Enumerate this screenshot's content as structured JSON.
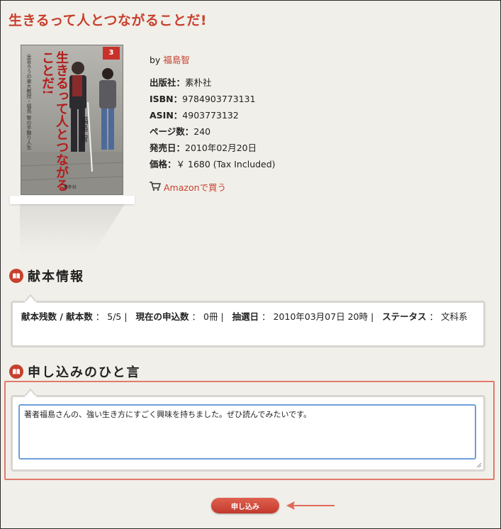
{
  "page": {
    "title": "生きるって人とつながることだ!"
  },
  "book": {
    "cover": {
      "badge": "3",
      "title": "生きるって人とつながることだ!",
      "subtitle": "全盲ろうの東大教授・福島 智の手触り人生",
      "author": "福島 智",
      "publisher": "素朴社"
    },
    "by_label": "by",
    "author": "福島智",
    "publisher_label": "出版社：",
    "publisher": "素朴社",
    "isbn_label": "ISBN：",
    "isbn": "9784903773131",
    "asin_label": "ASIN：",
    "asin": "4903773132",
    "pages_label": "ページ数：",
    "pages": "240",
    "release_label": "発売日：",
    "release": "2010年02月20日",
    "price_label": "価格：",
    "price": "￥ 1680 (Tax Included)",
    "amazon_link": "Amazonで買う"
  },
  "donation_info": {
    "heading": "献本情報",
    "remaining_label": "献本残数 / 献本数",
    "remaining_value": "5/5",
    "applications_label": "現在の申込数",
    "applications_value": "0冊",
    "lottery_label": "抽選日",
    "lottery_value": "2010年03月07日 20時",
    "status_label": "ステータス",
    "status_value": "文科系",
    "separator": "：",
    "pipe": "|"
  },
  "message": {
    "heading": "申し込みのひと言",
    "text": "著者福島さんの、強い生き方にすごく興味を持ちました。ぜひ読んでみたいです。"
  },
  "submit": {
    "label": "申し込み"
  },
  "colors": {
    "accent": "#c7402e",
    "focus": "#6f9fd8",
    "highlight_border": "#e07a6c"
  },
  "icons": [
    "cart-icon",
    "book-icon",
    "arrow-left-icon"
  ]
}
